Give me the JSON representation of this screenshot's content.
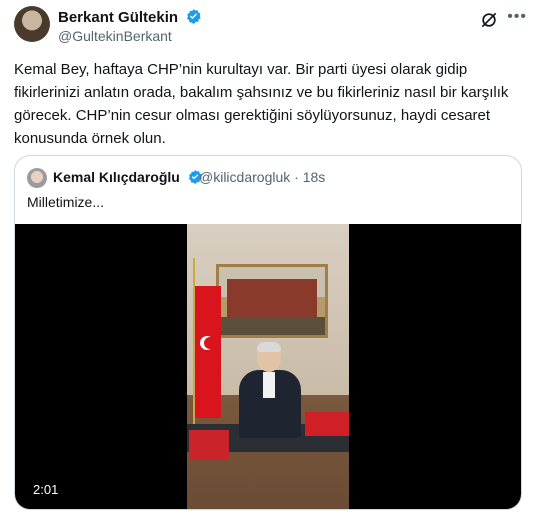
{
  "tweet": {
    "author_name": "Berkant Gültekin",
    "author_handle": "@GultekinBerkant",
    "text": "Kemal Bey, haftaya CHP’nin kurultayı var. Bir parti üyesi olarak gidip fikirlerinizi anlatın orada, bakalım şahsınız ve bu fikirleriniz nasıl bir karşılık görecek. CHP’nin cesur olması gerektiğini söylüyorsunuz, haydi cesaret konusunda örnek olun.",
    "icons": [
      "verified-badge-icon",
      "grok-icon",
      "more-icon"
    ],
    "verified_color": "#1d9bf0"
  },
  "quote": {
    "author_name": "Kemal Kılıçdaroğlu",
    "author_handle": "@kilicdarogluk · 18s",
    "text": "Milletimize...",
    "video_duration": "2:01"
  }
}
